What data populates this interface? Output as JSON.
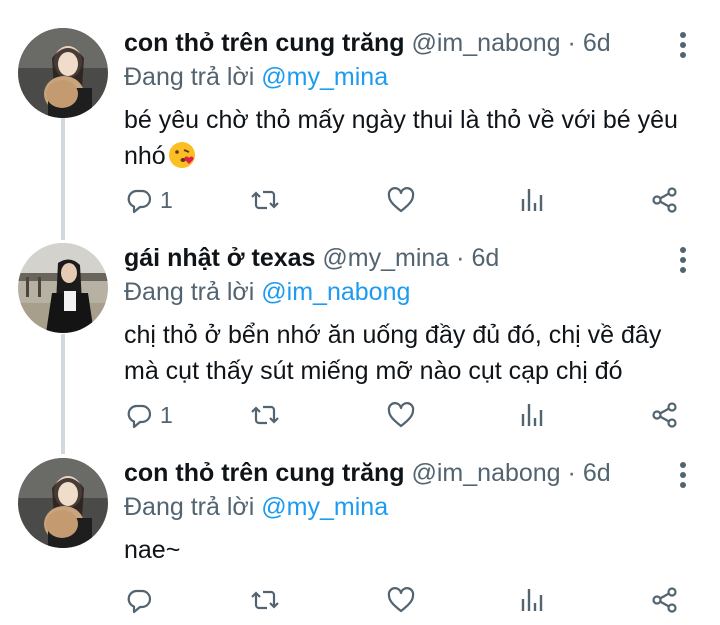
{
  "tweets": [
    {
      "name": "con thỏ trên cung trăng",
      "handle": "@im_nabong",
      "sep": "·",
      "time": "6d",
      "reply_prefix": "Đang trả lời",
      "reply_to": "@my_mina",
      "body": "bé yêu chờ thỏ mấy ngày thui là thỏ về với bé yêu nhó",
      "emoji": "face-blowing-kiss-emoji",
      "reply_count": "1"
    },
    {
      "name": "gái nhật ở texas",
      "handle": "@my_mina",
      "sep": "·",
      "time": "6d",
      "reply_prefix": "Đang trả lời",
      "reply_to": "@im_nabong",
      "body": "chị thỏ ở bển nhớ ăn uống đầy đủ đó, chị về đây mà cụt thấy sút miếng mỡ nào cụt cạp chị đó",
      "reply_count": "1"
    },
    {
      "name": "con thỏ trên cung trăng",
      "handle": "@im_nabong",
      "sep": "·",
      "time": "6d",
      "reply_prefix": "Đang trả lời",
      "reply_to": "@my_mina",
      "body": "nae~",
      "reply_count": ""
    }
  ],
  "icons": [
    "more-vertical-icon",
    "reply-icon",
    "retweet-icon",
    "like-icon",
    "analytics-icon",
    "share-icon"
  ],
  "colors": {
    "accent": "#1d9bf0",
    "text": "#0f1419",
    "muted": "#536471",
    "thread_line": "#cfd9de"
  }
}
